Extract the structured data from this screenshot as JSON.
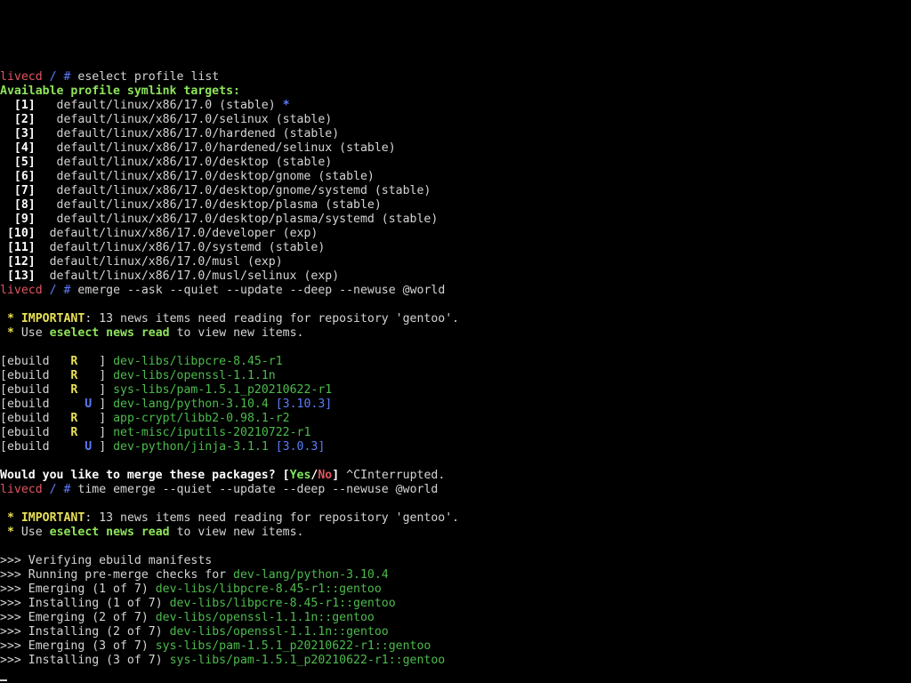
{
  "colors": {
    "background": "#000000",
    "default": "#d4d4d4",
    "host": "#e05561",
    "prompt_symbol": "#5c7cfa",
    "heading": "#8fe55a",
    "package": "#4cbb4c",
    "important": "#e8e055",
    "no": "#e05561",
    "version": "#5c7cfa"
  },
  "terminal": {
    "lines": [
      {
        "type": "prompt",
        "host": "livecd",
        "path": "/",
        "symbol": "#",
        "command": "eselect profile list"
      },
      {
        "type": "heading",
        "text": "Available profile symlink targets:"
      },
      {
        "type": "profile",
        "index": "[1]",
        "path": "default/linux/x86/17.0",
        "status": "(stable)",
        "selected": "*"
      },
      {
        "type": "profile",
        "index": "[2]",
        "path": "default/linux/x86/17.0/selinux",
        "status": "(stable)"
      },
      {
        "type": "profile",
        "index": "[3]",
        "path": "default/linux/x86/17.0/hardened",
        "status": "(stable)"
      },
      {
        "type": "profile",
        "index": "[4]",
        "path": "default/linux/x86/17.0/hardened/selinux",
        "status": "(stable)"
      },
      {
        "type": "profile",
        "index": "[5]",
        "path": "default/linux/x86/17.0/desktop",
        "status": "(stable)"
      },
      {
        "type": "profile",
        "index": "[6]",
        "path": "default/linux/x86/17.0/desktop/gnome",
        "status": "(stable)"
      },
      {
        "type": "profile",
        "index": "[7]",
        "path": "default/linux/x86/17.0/desktop/gnome/systemd",
        "status": "(stable)"
      },
      {
        "type": "profile",
        "index": "[8]",
        "path": "default/linux/x86/17.0/desktop/plasma",
        "status": "(stable)"
      },
      {
        "type": "profile",
        "index": "[9]",
        "path": "default/linux/x86/17.0/desktop/plasma/systemd",
        "status": "(stable)"
      },
      {
        "type": "profile",
        "index": "[10]",
        "path": "default/linux/x86/17.0/developer",
        "status": "(exp)"
      },
      {
        "type": "profile",
        "index": "[11]",
        "path": "default/linux/x86/17.0/systemd",
        "status": "(stable)"
      },
      {
        "type": "profile",
        "index": "[12]",
        "path": "default/linux/x86/17.0/musl",
        "status": "(exp)"
      },
      {
        "type": "profile",
        "index": "[13]",
        "path": "default/linux/x86/17.0/musl/selinux",
        "status": "(exp)"
      },
      {
        "type": "prompt",
        "host": "livecd",
        "path": "/",
        "symbol": "#",
        "command": "emerge --ask --quiet --update --deep --newuse @world"
      },
      {
        "type": "blank"
      },
      {
        "type": "important",
        "star": "*",
        "label": "IMPORTANT",
        "text": ": 13 news items need reading for repository 'gentoo'."
      },
      {
        "type": "news",
        "star": "*",
        "prefix": "Use",
        "cmd": "eselect news read",
        "suffix": "to view new items."
      },
      {
        "type": "blank"
      },
      {
        "type": "ebuild",
        "label": "[ebuild",
        "flag": "R",
        "flag_col": "r",
        "close": "]",
        "pkg": "dev-libs/libpcre-8.45-r1"
      },
      {
        "type": "ebuild",
        "label": "[ebuild",
        "flag": "R",
        "flag_col": "r",
        "close": "]",
        "pkg": "dev-libs/openssl-1.1.1n"
      },
      {
        "type": "ebuild",
        "label": "[ebuild",
        "flag": "R",
        "flag_col": "r",
        "close": "]",
        "pkg": "sys-libs/pam-1.5.1_p20210622-r1"
      },
      {
        "type": "ebuild",
        "label": "[ebuild",
        "flag": "U",
        "flag_col": "u",
        "close": "]",
        "pkg": "dev-lang/python-3.10.4",
        "old": "[3.10.3]"
      },
      {
        "type": "ebuild",
        "label": "[ebuild",
        "flag": "R",
        "flag_col": "r",
        "close": "]",
        "pkg": "app-crypt/libb2-0.98.1-r2"
      },
      {
        "type": "ebuild",
        "label": "[ebuild",
        "flag": "R",
        "flag_col": "r",
        "close": "]",
        "pkg": "net-misc/iputils-20210722-r1"
      },
      {
        "type": "ebuild",
        "label": "[ebuild",
        "flag": "U",
        "flag_col": "u",
        "close": "]",
        "pkg": "dev-python/jinja-3.1.1",
        "old": "[3.0.3]"
      },
      {
        "type": "blank"
      },
      {
        "type": "merge_question",
        "question": "Would you like to merge these packages?",
        "open": "[",
        "yes": "Yes",
        "sep": "/",
        "no": "No",
        "close": "]",
        "tail": "^CInterrupted."
      },
      {
        "type": "prompt",
        "host": "livecd",
        "path": "/",
        "symbol": "#",
        "command": "time emerge --quiet --update --deep --newuse @world"
      },
      {
        "type": "blank"
      },
      {
        "type": "important",
        "star": "*",
        "label": "IMPORTANT",
        "text": ": 13 news items need reading for repository 'gentoo'."
      },
      {
        "type": "news",
        "star": "*",
        "prefix": "Use",
        "cmd": "eselect news read",
        "suffix": "to view new items."
      },
      {
        "type": "blank"
      },
      {
        "type": "progress",
        "arrows": ">>>",
        "text": "Verifying ebuild manifests"
      },
      {
        "type": "progress",
        "arrows": ">>>",
        "text": "Running pre-merge checks for",
        "pkg": "dev-lang/python-3.10.4"
      },
      {
        "type": "progress",
        "arrows": ">>>",
        "text": "Emerging (1 of 7)",
        "pkg": "dev-libs/libpcre-8.45-r1::gentoo"
      },
      {
        "type": "progress",
        "arrows": ">>>",
        "text": "Installing (1 of 7)",
        "pkg": "dev-libs/libpcre-8.45-r1::gentoo"
      },
      {
        "type": "progress",
        "arrows": ">>>",
        "text": "Emerging (2 of 7)",
        "pkg": "dev-libs/openssl-1.1.1n::gentoo"
      },
      {
        "type": "progress",
        "arrows": ">>>",
        "text": "Installing (2 of 7)",
        "pkg": "dev-libs/openssl-1.1.1n::gentoo"
      },
      {
        "type": "progress",
        "arrows": ">>>",
        "text": "Emerging (3 of 7)",
        "pkg": "sys-libs/pam-1.5.1_p20210622-r1::gentoo"
      },
      {
        "type": "progress",
        "arrows": ">>>",
        "text": "Installing (3 of 7)",
        "pkg": "sys-libs/pam-1.5.1_p20210622-r1::gentoo"
      }
    ]
  }
}
